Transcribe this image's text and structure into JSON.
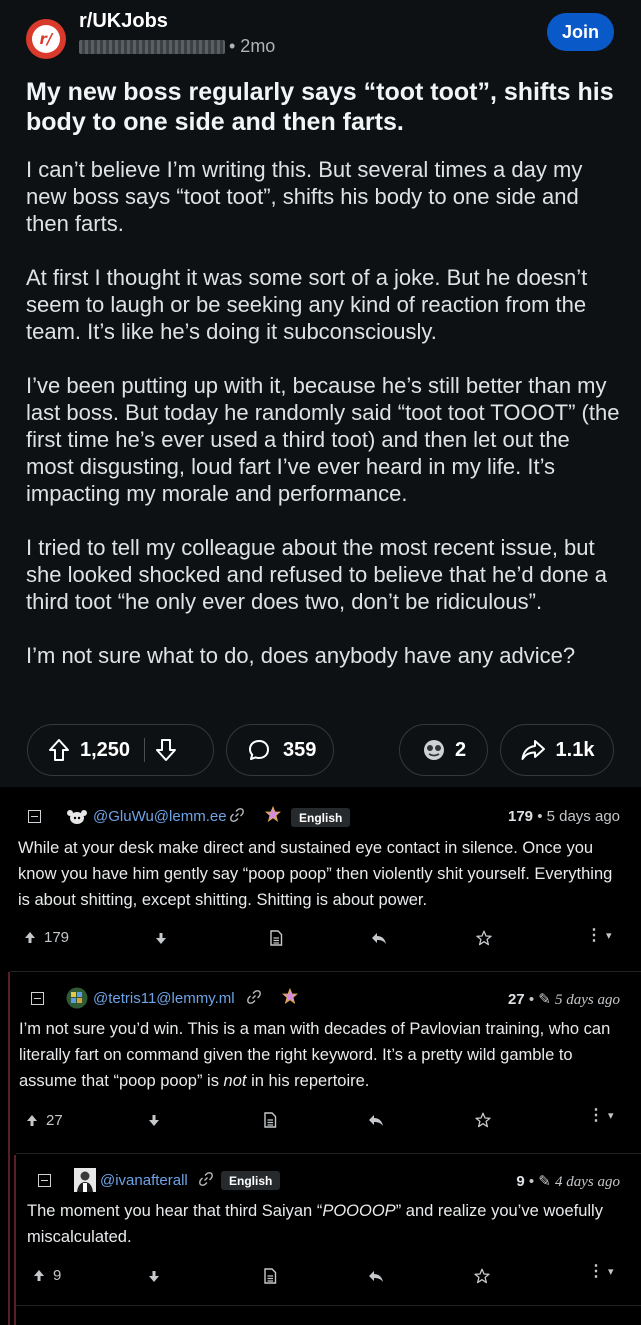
{
  "reddit": {
    "subreddit": "r/UKJobs",
    "age": "• 2mo",
    "join_label": "Join",
    "title": "My new boss regularly says “toot toot”, shifts his body to one side and then farts.",
    "paragraphs": [
      "I can’t believe I’m writing this. But several times a day my new boss says “toot toot”, shifts his body to one side and then farts.",
      "At first I thought it was some sort of a joke. But he doesn’t seem to laugh or be seeking any kind of reaction from the team. It’s like he’s doing it subconsciously.",
      "I’ve been putting up with it, because he’s still better than my last boss. But today he randomly said “toot toot TOOOT” (the first time he’s ever used a third toot) and then let out the most disgusting, loud fart I’ve ever heard in my life. It’s impacting my morale and performance.",
      "I tried to tell my colleague about the most recent issue, but she looked shocked and refused to believe that he’d done a third toot “he only ever does two, don’t be ridiculous”.",
      "I’m not sure what to do, does anybody have any advice?"
    ],
    "votes": "1,250",
    "comments": "359",
    "awards": "2",
    "share": "1.1k"
  },
  "lemmy": {
    "comments": [
      {
        "user": "@GluWu@lemm.ee",
        "language": "English",
        "score": "179",
        "time": "5 days ago",
        "text": "While at your desk make direct and sustained eye contact in silence. Once you know you have him gently say “poop poop” then violently shit yourself. Everything is about shitting, except shitting. Shitting is about power.",
        "upvotes": "179"
      },
      {
        "user": "@tetris11@lemmy.ml",
        "score": "27",
        "time": "5 days ago",
        "text_before": "I’m not sure you’d win. This is a man with decades of Pavlovian training, who can literally fart on command given the right keyword. It’s a pretty wild gamble to assume that “poop poop” is ",
        "text_em": "not",
        "text_after": " in his repertoire.",
        "upvotes": "27"
      },
      {
        "user": "@ivanafterall",
        "language": "English",
        "score": "9",
        "time": "4 days ago",
        "text_before": "The moment you hear that third Saiyan “",
        "text_em": "POOOOP",
        "text_after": "” and realize you’ve woefully miscalculated.",
        "upvotes": "9"
      }
    ]
  },
  "icons": {
    "link": "🔗",
    "creator_star": "✷",
    "more": "⋮",
    "caret": "▾"
  },
  "colors": {
    "reddit_bg": "#0e1113",
    "join_button": "#0a59c8",
    "lemmy_bg": "#000000",
    "username": "#6ea3e6",
    "thread_line": "#5a1f24"
  }
}
